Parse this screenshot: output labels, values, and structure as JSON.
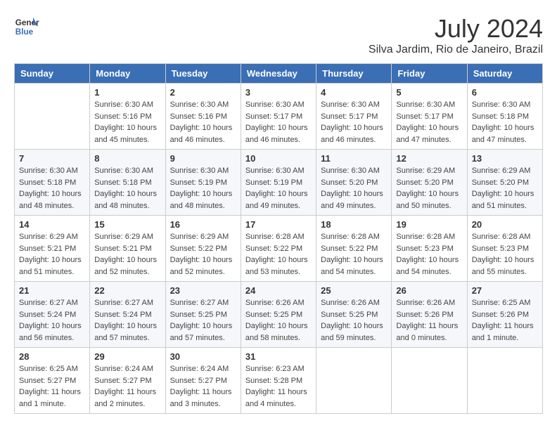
{
  "header": {
    "logo_line1": "General",
    "logo_line2": "Blue",
    "month_year": "July 2024",
    "location": "Silva Jardim, Rio de Janeiro, Brazil"
  },
  "days_of_week": [
    "Sunday",
    "Monday",
    "Tuesday",
    "Wednesday",
    "Thursday",
    "Friday",
    "Saturday"
  ],
  "weeks": [
    [
      {
        "day": "",
        "content": ""
      },
      {
        "day": "1",
        "content": "Sunrise: 6:30 AM\nSunset: 5:16 PM\nDaylight: 10 hours\nand 45 minutes."
      },
      {
        "day": "2",
        "content": "Sunrise: 6:30 AM\nSunset: 5:16 PM\nDaylight: 10 hours\nand 46 minutes."
      },
      {
        "day": "3",
        "content": "Sunrise: 6:30 AM\nSunset: 5:17 PM\nDaylight: 10 hours\nand 46 minutes."
      },
      {
        "day": "4",
        "content": "Sunrise: 6:30 AM\nSunset: 5:17 PM\nDaylight: 10 hours\nand 46 minutes."
      },
      {
        "day": "5",
        "content": "Sunrise: 6:30 AM\nSunset: 5:17 PM\nDaylight: 10 hours\nand 47 minutes."
      },
      {
        "day": "6",
        "content": "Sunrise: 6:30 AM\nSunset: 5:18 PM\nDaylight: 10 hours\nand 47 minutes."
      }
    ],
    [
      {
        "day": "7",
        "content": "Sunrise: 6:30 AM\nSunset: 5:18 PM\nDaylight: 10 hours\nand 48 minutes."
      },
      {
        "day": "8",
        "content": "Sunrise: 6:30 AM\nSunset: 5:18 PM\nDaylight: 10 hours\nand 48 minutes."
      },
      {
        "day": "9",
        "content": "Sunrise: 6:30 AM\nSunset: 5:19 PM\nDaylight: 10 hours\nand 48 minutes."
      },
      {
        "day": "10",
        "content": "Sunrise: 6:30 AM\nSunset: 5:19 PM\nDaylight: 10 hours\nand 49 minutes."
      },
      {
        "day": "11",
        "content": "Sunrise: 6:30 AM\nSunset: 5:20 PM\nDaylight: 10 hours\nand 49 minutes."
      },
      {
        "day": "12",
        "content": "Sunrise: 6:29 AM\nSunset: 5:20 PM\nDaylight: 10 hours\nand 50 minutes."
      },
      {
        "day": "13",
        "content": "Sunrise: 6:29 AM\nSunset: 5:20 PM\nDaylight: 10 hours\nand 51 minutes."
      }
    ],
    [
      {
        "day": "14",
        "content": "Sunrise: 6:29 AM\nSunset: 5:21 PM\nDaylight: 10 hours\nand 51 minutes."
      },
      {
        "day": "15",
        "content": "Sunrise: 6:29 AM\nSunset: 5:21 PM\nDaylight: 10 hours\nand 52 minutes."
      },
      {
        "day": "16",
        "content": "Sunrise: 6:29 AM\nSunset: 5:22 PM\nDaylight: 10 hours\nand 52 minutes."
      },
      {
        "day": "17",
        "content": "Sunrise: 6:28 AM\nSunset: 5:22 PM\nDaylight: 10 hours\nand 53 minutes."
      },
      {
        "day": "18",
        "content": "Sunrise: 6:28 AM\nSunset: 5:22 PM\nDaylight: 10 hours\nand 54 minutes."
      },
      {
        "day": "19",
        "content": "Sunrise: 6:28 AM\nSunset: 5:23 PM\nDaylight: 10 hours\nand 54 minutes."
      },
      {
        "day": "20",
        "content": "Sunrise: 6:28 AM\nSunset: 5:23 PM\nDaylight: 10 hours\nand 55 minutes."
      }
    ],
    [
      {
        "day": "21",
        "content": "Sunrise: 6:27 AM\nSunset: 5:24 PM\nDaylight: 10 hours\nand 56 minutes."
      },
      {
        "day": "22",
        "content": "Sunrise: 6:27 AM\nSunset: 5:24 PM\nDaylight: 10 hours\nand 57 minutes."
      },
      {
        "day": "23",
        "content": "Sunrise: 6:27 AM\nSunset: 5:25 PM\nDaylight: 10 hours\nand 57 minutes."
      },
      {
        "day": "24",
        "content": "Sunrise: 6:26 AM\nSunset: 5:25 PM\nDaylight: 10 hours\nand 58 minutes."
      },
      {
        "day": "25",
        "content": "Sunrise: 6:26 AM\nSunset: 5:25 PM\nDaylight: 10 hours\nand 59 minutes."
      },
      {
        "day": "26",
        "content": "Sunrise: 6:26 AM\nSunset: 5:26 PM\nDaylight: 11 hours\nand 0 minutes."
      },
      {
        "day": "27",
        "content": "Sunrise: 6:25 AM\nSunset: 5:26 PM\nDaylight: 11 hours\nand 1 minute."
      }
    ],
    [
      {
        "day": "28",
        "content": "Sunrise: 6:25 AM\nSunset: 5:27 PM\nDaylight: 11 hours\nand 1 minute."
      },
      {
        "day": "29",
        "content": "Sunrise: 6:24 AM\nSunset: 5:27 PM\nDaylight: 11 hours\nand 2 minutes."
      },
      {
        "day": "30",
        "content": "Sunrise: 6:24 AM\nSunset: 5:27 PM\nDaylight: 11 hours\nand 3 minutes."
      },
      {
        "day": "31",
        "content": "Sunrise: 6:23 AM\nSunset: 5:28 PM\nDaylight: 11 hours\nand 4 minutes."
      },
      {
        "day": "",
        "content": ""
      },
      {
        "day": "",
        "content": ""
      },
      {
        "day": "",
        "content": ""
      }
    ]
  ]
}
